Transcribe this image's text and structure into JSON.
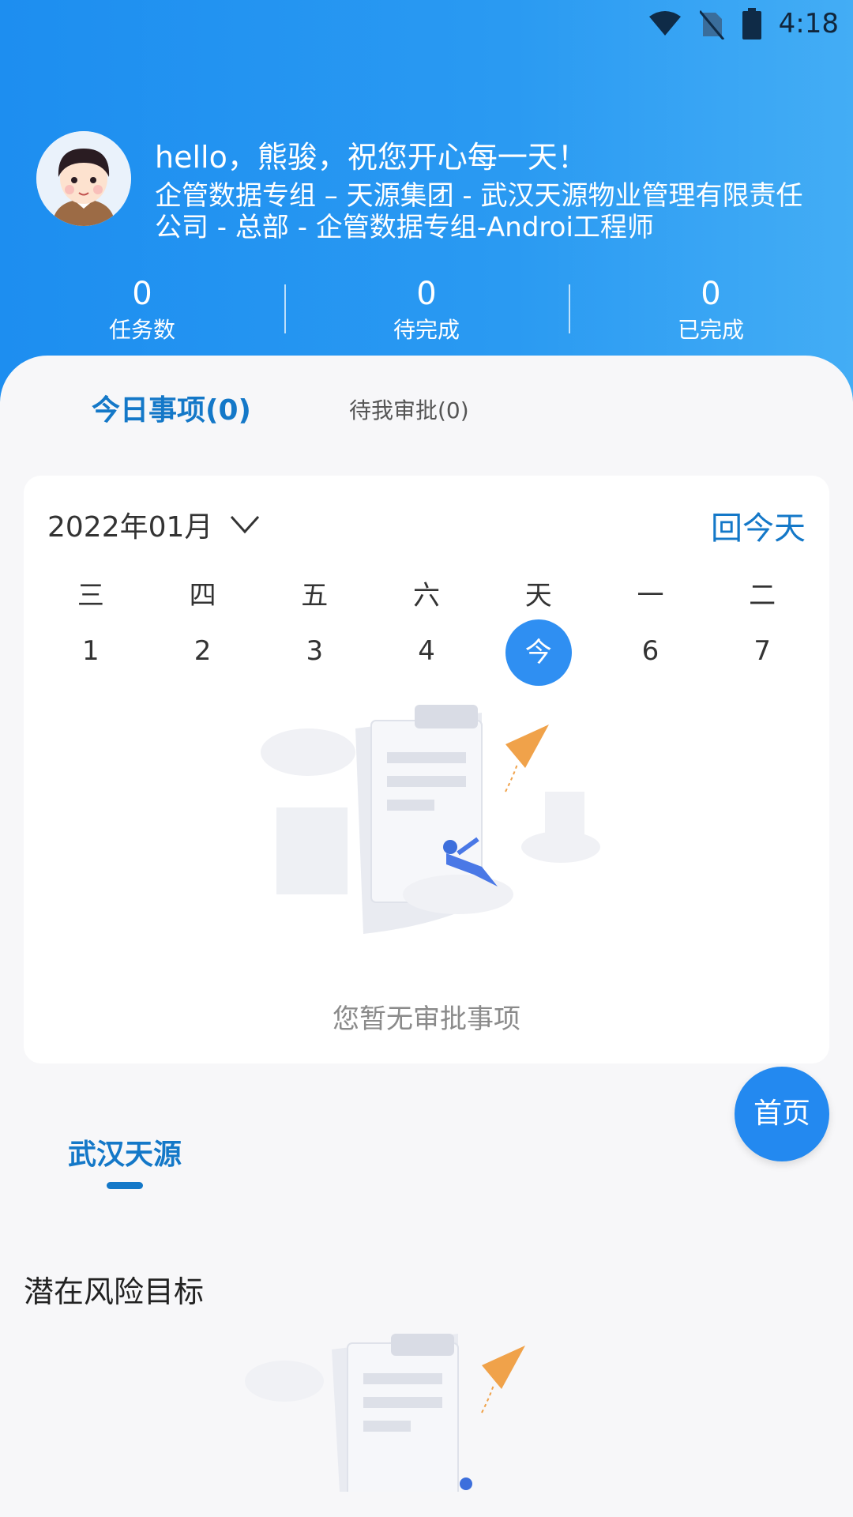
{
  "status_bar": {
    "time": "4:18",
    "icons": [
      "wifi-icon",
      "no-sim-icon",
      "battery-icon"
    ]
  },
  "header": {
    "greeting": "hello，熊骏，祝您开心每一天！",
    "org_line": "企管数据专组 – 天源集团 - 武汉天源物业管理有限责任公司 - 总部 - 企管数据专组-Androi工程师",
    "stats": [
      {
        "value": "0",
        "label": "任务数"
      },
      {
        "value": "0",
        "label": "待完成"
      },
      {
        "value": "0",
        "label": "已完成"
      }
    ]
  },
  "tabs": {
    "active": "今日事项(0)",
    "inactive": "待我审批(0)"
  },
  "calendar": {
    "month": "2022年01月",
    "today_button": "回今天",
    "weekdays": [
      "三",
      "四",
      "五",
      "六",
      "天",
      "一",
      "二"
    ],
    "days": [
      "1",
      "2",
      "3",
      "4",
      "今",
      "6",
      "7"
    ],
    "today_index": 4,
    "empty_text": "您暂无审批事项"
  },
  "fab": {
    "label": "首页"
  },
  "company_tab": {
    "label": "武汉天源"
  },
  "risk_section": {
    "title": "潜在风险目标"
  },
  "colors": {
    "primary": "#1478c8",
    "header_start": "#1d8ef0",
    "header_end": "#43adf5",
    "today_circle": "#2f8ff2"
  }
}
